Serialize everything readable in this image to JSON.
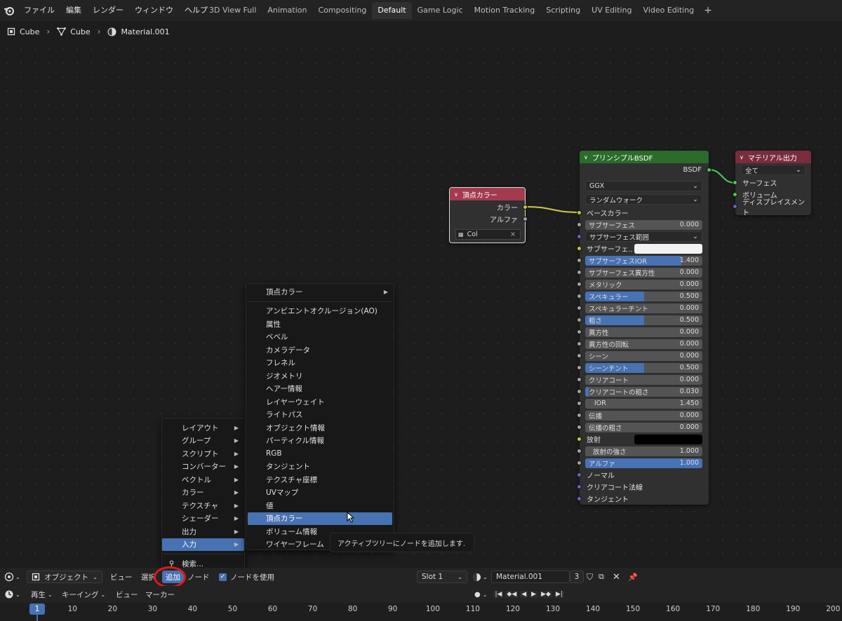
{
  "topbar": {
    "menus": [
      "ファイル",
      "編集",
      "レンダー",
      "ウィンドウ",
      "ヘルプ"
    ],
    "tabs": [
      "3D View Full",
      "Animation",
      "Compositing",
      "Default",
      "Game Logic",
      "Motion Tracking",
      "Scripting",
      "UV Editing",
      "Video Editing"
    ],
    "add_tab": "+",
    "active_tab": 3
  },
  "breadcrumb": {
    "object": "Cube",
    "mesh": "Cube",
    "material": "Material.001"
  },
  "vertex_node": {
    "title": "頂点カラー",
    "out_color": "カラー",
    "out_alpha": "アルファ",
    "layer": "Col",
    "color": "#a33a4e"
  },
  "bsdf_node": {
    "title": "プリンシプルBSDF",
    "output": "BSDF",
    "distribution": "GGX",
    "subsurface_method": "ランダムウォーク",
    "base_color": "ベースカラー",
    "color": "#2b6b2b",
    "rows": [
      {
        "label": "サブサーフェス",
        "value": "0.000",
        "fill": 0
      },
      {
        "label": "サブサーフェス範囲",
        "value": "",
        "fill": 0
      },
      {
        "label": "サブサーフェ..",
        "value": "",
        "fill": 0
      },
      {
        "label": "サブサーフェスIOR",
        "value": "1.400",
        "fill": 0.82
      },
      {
        "label": "サブサーフェス異方性",
        "value": "0.000",
        "fill": 0
      },
      {
        "label": "メタリック",
        "value": "0.000",
        "fill": 0
      },
      {
        "label": "スペキュラー",
        "value": "0.500",
        "fill": 0.5
      },
      {
        "label": "スペキュラーチント",
        "value": "0.000",
        "fill": 0
      },
      {
        "label": "粗さ",
        "value": "0.500",
        "fill": 0.5
      },
      {
        "label": "異方性",
        "value": "0.000",
        "fill": 0
      },
      {
        "label": "異方性の回転",
        "value": "0.000",
        "fill": 0
      },
      {
        "label": "シーン",
        "value": "0.000",
        "fill": 0
      },
      {
        "label": "シーンチント",
        "value": "0.500",
        "fill": 0.5
      },
      {
        "label": "クリアコート",
        "value": "0.000",
        "fill": 0
      },
      {
        "label": "クリアコートの粗さ",
        "value": "0.030",
        "fill": 0.03
      },
      {
        "label": "IOR",
        "value": "1.450",
        "fill": 0
      },
      {
        "label": "伝播",
        "value": "0.000",
        "fill": 0
      },
      {
        "label": "伝播の粗さ",
        "value": "0.000",
        "fill": 0
      },
      {
        "label": "放射",
        "value": "",
        "fill": 0
      },
      {
        "label": "放射の強さ",
        "value": "1.000",
        "fill": 0
      },
      {
        "label": "アルファ",
        "value": "1.000",
        "fill": 1
      },
      {
        "label": "ノーマル",
        "value": "",
        "fill": 0
      },
      {
        "label": "クリアコート法線",
        "value": "",
        "fill": 0
      },
      {
        "label": "タンジェント",
        "value": "",
        "fill": 0
      }
    ]
  },
  "output_node": {
    "title": "マテリアル出力",
    "target": "全て",
    "inputs": [
      "サーフェス",
      "ボリューム",
      "ディスプレイスメント"
    ],
    "color": "#7a2c3c"
  },
  "add_menu": {
    "items": [
      "レイアウト",
      "グループ",
      "スクリプト",
      "コンバーター",
      "ベクトル",
      "カラー",
      "テクスチャ",
      "シェーダー",
      "出力",
      "入力"
    ],
    "search": "検索..."
  },
  "input_menu": {
    "header": "頂点カラー",
    "items": [
      "アンビエントオクルージョン(AO)",
      "属性",
      "ベベル",
      "カメラデータ",
      "フレネル",
      "ジオメトリ",
      "ヘアー情報",
      "レイヤーウェイト",
      "ライトパス",
      "オブジェクト情報",
      "パーティクル情報",
      "RGB",
      "タンジェント",
      "テクスチャ座標",
      "UVマップ",
      "値",
      "頂点カラー",
      "ボリューム情報",
      "ワイヤーフレーム"
    ]
  },
  "tooltip": "アクティブツリーにノードを追加します.",
  "header": {
    "mode": "オブジェクト",
    "view": "ビュー",
    "select": "選択",
    "add": "追加",
    "node": "ノード",
    "use_nodes": "ノードを使用",
    "slot": "Slot 1",
    "material": "Material.001",
    "users": "3"
  },
  "timeline": {
    "play": "再生",
    "keying": "キーイング",
    "view": "ビュー",
    "marker": "マーカー",
    "current": "1",
    "ticks": [
      "10",
      "20",
      "30",
      "40",
      "50",
      "60",
      "70",
      "80",
      "90",
      "100",
      "110",
      "120",
      "130",
      "140",
      "150",
      "160",
      "170",
      "180",
      "190",
      "200"
    ]
  }
}
